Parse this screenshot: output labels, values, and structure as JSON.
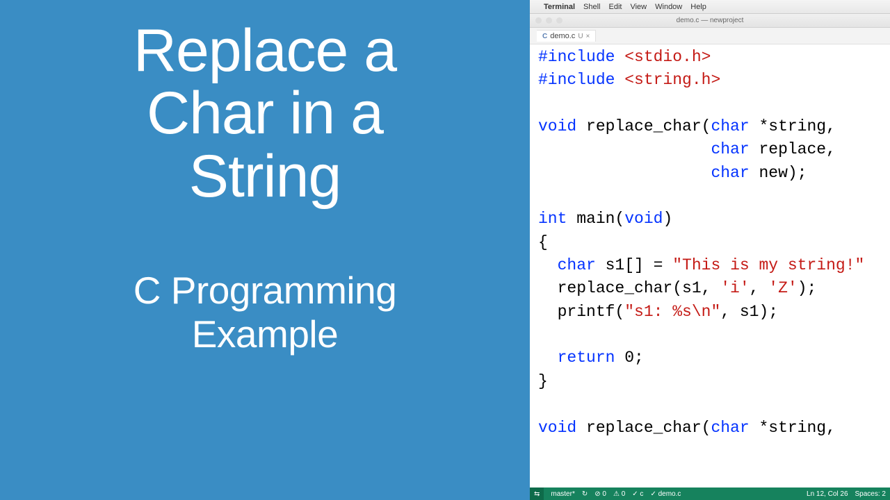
{
  "left": {
    "title": "Replace a\nChar in a\nString",
    "subtitle": "C Programming\nExample"
  },
  "menubar": {
    "app": "Terminal",
    "items": [
      "Shell",
      "Edit",
      "View",
      "Window",
      "Help"
    ]
  },
  "window": {
    "title": "demo.c — newproject"
  },
  "tab": {
    "lang": "C",
    "filename": "demo.c",
    "vcs": "U",
    "close": "×"
  },
  "code": {
    "l1a": "#include",
    "l1b": " <stdio.h>",
    "l2a": "#include",
    "l2b": " <string.h>",
    "l4a": "void",
    "l4b": " replace_char(",
    "l4c": "char",
    "l4d": " *string,",
    "l5a": "char",
    "l5b": " replace,",
    "l6a": "char",
    "l6b": " new);",
    "l8a": "int",
    "l8b": " main(",
    "l8c": "void",
    "l8d": ")",
    "l9": "{",
    "l10a": "  ",
    "l10b": "char",
    "l10c": " s1[] = ",
    "l10d": "\"This is my string!\"",
    "l11": "  replace_char(s1, ",
    "l11b": "'i'",
    "l11c": ", ",
    "l11d": "'Z'",
    "l11e": ");",
    "l12": "  printf(",
    "l12b": "\"s1: %s\\n\"",
    "l12c": ", s1);",
    "l14a": "  ",
    "l14b": "return",
    "l14c": " 0;",
    "l15": "}",
    "l17a": "void",
    "l17b": " replace_char(",
    "l17c": "char",
    "l17d": " *string,"
  },
  "status": {
    "remote": "⇆",
    "branch": "master*",
    "sync": "↻",
    "err": "⊘ 0",
    "warn": "⚠ 0",
    "lang1": "✓ c",
    "lang2": "✓ demo.c",
    "pos": "Ln 12, Col 26",
    "spaces": "Spaces: 2"
  }
}
